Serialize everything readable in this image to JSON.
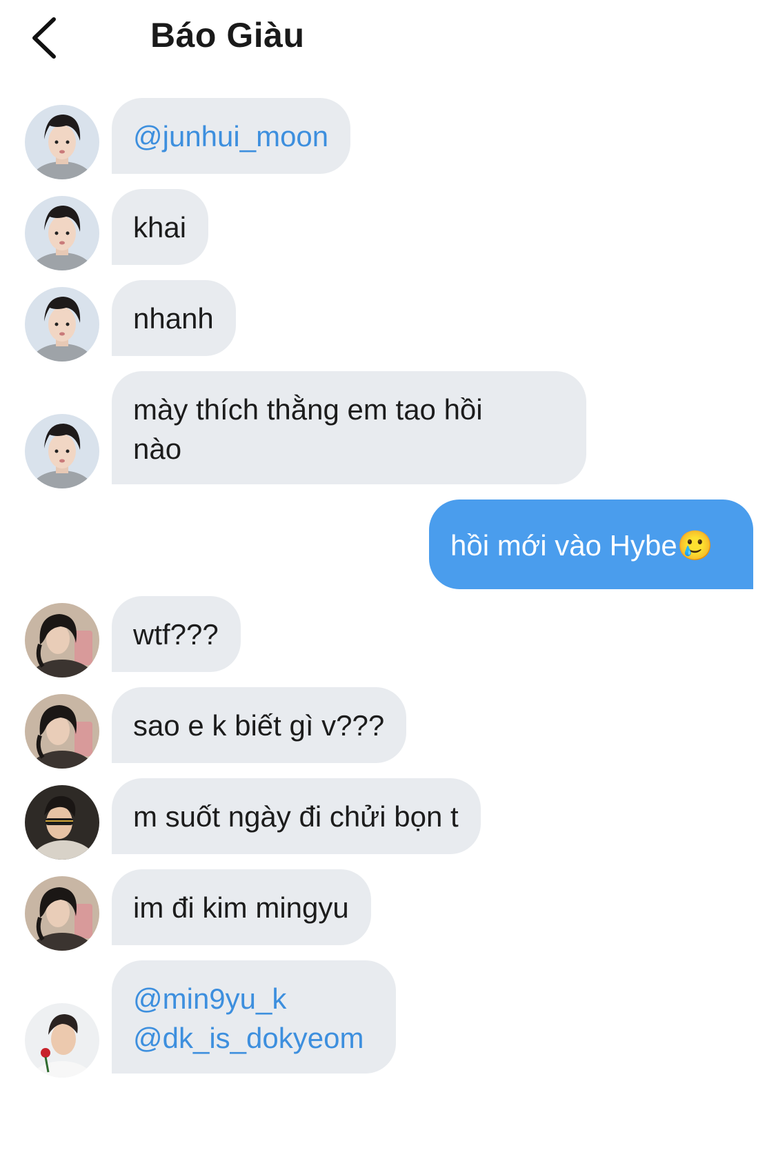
{
  "header": {
    "title": "Báo Giàu"
  },
  "messages": [
    {
      "text": "@junhui_moon"
    },
    {
      "text": "khai"
    },
    {
      "text": "nhanh"
    },
    {
      "line1": "mày thích thằng em tao hồi",
      "line2": "nào"
    },
    {
      "text": "hồi mới vào Hybe🥲"
    },
    {
      "text": "wtf???"
    },
    {
      "text": "sao e k biết gì v???"
    },
    {
      "text": "m suốt ngày đi chửi bọn t"
    },
    {
      "text": "im đi kim mingyu"
    },
    {
      "line1": "@min9yu_k",
      "line2": "@dk_is_dokyeom"
    }
  ],
  "colors": {
    "received_bubble": "#e8ebef",
    "sent_bubble": "#4a9ded",
    "mention": "#3d8fde"
  },
  "icons": {
    "back": "chevron-left-icon"
  }
}
